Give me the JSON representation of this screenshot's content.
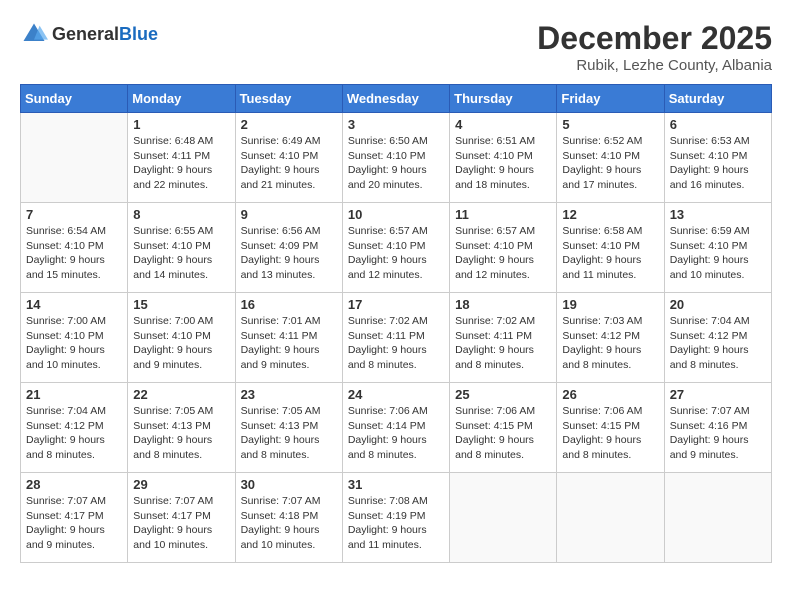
{
  "header": {
    "logo_general": "General",
    "logo_blue": "Blue",
    "month": "December 2025",
    "location": "Rubik, Lezhe County, Albania"
  },
  "days_of_week": [
    "Sunday",
    "Monday",
    "Tuesday",
    "Wednesday",
    "Thursday",
    "Friday",
    "Saturday"
  ],
  "weeks": [
    [
      {
        "day": "",
        "sunrise": "",
        "sunset": "",
        "daylight": ""
      },
      {
        "day": "1",
        "sunrise": "Sunrise: 6:48 AM",
        "sunset": "Sunset: 4:11 PM",
        "daylight": "Daylight: 9 hours and 22 minutes."
      },
      {
        "day": "2",
        "sunrise": "Sunrise: 6:49 AM",
        "sunset": "Sunset: 4:10 PM",
        "daylight": "Daylight: 9 hours and 21 minutes."
      },
      {
        "day": "3",
        "sunrise": "Sunrise: 6:50 AM",
        "sunset": "Sunset: 4:10 PM",
        "daylight": "Daylight: 9 hours and 20 minutes."
      },
      {
        "day": "4",
        "sunrise": "Sunrise: 6:51 AM",
        "sunset": "Sunset: 4:10 PM",
        "daylight": "Daylight: 9 hours and 18 minutes."
      },
      {
        "day": "5",
        "sunrise": "Sunrise: 6:52 AM",
        "sunset": "Sunset: 4:10 PM",
        "daylight": "Daylight: 9 hours and 17 minutes."
      },
      {
        "day": "6",
        "sunrise": "Sunrise: 6:53 AM",
        "sunset": "Sunset: 4:10 PM",
        "daylight": "Daylight: 9 hours and 16 minutes."
      }
    ],
    [
      {
        "day": "7",
        "sunrise": "Sunrise: 6:54 AM",
        "sunset": "Sunset: 4:10 PM",
        "daylight": "Daylight: 9 hours and 15 minutes."
      },
      {
        "day": "8",
        "sunrise": "Sunrise: 6:55 AM",
        "sunset": "Sunset: 4:10 PM",
        "daylight": "Daylight: 9 hours and 14 minutes."
      },
      {
        "day": "9",
        "sunrise": "Sunrise: 6:56 AM",
        "sunset": "Sunset: 4:09 PM",
        "daylight": "Daylight: 9 hours and 13 minutes."
      },
      {
        "day": "10",
        "sunrise": "Sunrise: 6:57 AM",
        "sunset": "Sunset: 4:10 PM",
        "daylight": "Daylight: 9 hours and 12 minutes."
      },
      {
        "day": "11",
        "sunrise": "Sunrise: 6:57 AM",
        "sunset": "Sunset: 4:10 PM",
        "daylight": "Daylight: 9 hours and 12 minutes."
      },
      {
        "day": "12",
        "sunrise": "Sunrise: 6:58 AM",
        "sunset": "Sunset: 4:10 PM",
        "daylight": "Daylight: 9 hours and 11 minutes."
      },
      {
        "day": "13",
        "sunrise": "Sunrise: 6:59 AM",
        "sunset": "Sunset: 4:10 PM",
        "daylight": "Daylight: 9 hours and 10 minutes."
      }
    ],
    [
      {
        "day": "14",
        "sunrise": "Sunrise: 7:00 AM",
        "sunset": "Sunset: 4:10 PM",
        "daylight": "Daylight: 9 hours and 10 minutes."
      },
      {
        "day": "15",
        "sunrise": "Sunrise: 7:00 AM",
        "sunset": "Sunset: 4:10 PM",
        "daylight": "Daylight: 9 hours and 9 minutes."
      },
      {
        "day": "16",
        "sunrise": "Sunrise: 7:01 AM",
        "sunset": "Sunset: 4:11 PM",
        "daylight": "Daylight: 9 hours and 9 minutes."
      },
      {
        "day": "17",
        "sunrise": "Sunrise: 7:02 AM",
        "sunset": "Sunset: 4:11 PM",
        "daylight": "Daylight: 9 hours and 8 minutes."
      },
      {
        "day": "18",
        "sunrise": "Sunrise: 7:02 AM",
        "sunset": "Sunset: 4:11 PM",
        "daylight": "Daylight: 9 hours and 8 minutes."
      },
      {
        "day": "19",
        "sunrise": "Sunrise: 7:03 AM",
        "sunset": "Sunset: 4:12 PM",
        "daylight": "Daylight: 9 hours and 8 minutes."
      },
      {
        "day": "20",
        "sunrise": "Sunrise: 7:04 AM",
        "sunset": "Sunset: 4:12 PM",
        "daylight": "Daylight: 9 hours and 8 minutes."
      }
    ],
    [
      {
        "day": "21",
        "sunrise": "Sunrise: 7:04 AM",
        "sunset": "Sunset: 4:12 PM",
        "daylight": "Daylight: 9 hours and 8 minutes."
      },
      {
        "day": "22",
        "sunrise": "Sunrise: 7:05 AM",
        "sunset": "Sunset: 4:13 PM",
        "daylight": "Daylight: 9 hours and 8 minutes."
      },
      {
        "day": "23",
        "sunrise": "Sunrise: 7:05 AM",
        "sunset": "Sunset: 4:13 PM",
        "daylight": "Daylight: 9 hours and 8 minutes."
      },
      {
        "day": "24",
        "sunrise": "Sunrise: 7:06 AM",
        "sunset": "Sunset: 4:14 PM",
        "daylight": "Daylight: 9 hours and 8 minutes."
      },
      {
        "day": "25",
        "sunrise": "Sunrise: 7:06 AM",
        "sunset": "Sunset: 4:15 PM",
        "daylight": "Daylight: 9 hours and 8 minutes."
      },
      {
        "day": "26",
        "sunrise": "Sunrise: 7:06 AM",
        "sunset": "Sunset: 4:15 PM",
        "daylight": "Daylight: 9 hours and 8 minutes."
      },
      {
        "day": "27",
        "sunrise": "Sunrise: 7:07 AM",
        "sunset": "Sunset: 4:16 PM",
        "daylight": "Daylight: 9 hours and 9 minutes."
      }
    ],
    [
      {
        "day": "28",
        "sunrise": "Sunrise: 7:07 AM",
        "sunset": "Sunset: 4:17 PM",
        "daylight": "Daylight: 9 hours and 9 minutes."
      },
      {
        "day": "29",
        "sunrise": "Sunrise: 7:07 AM",
        "sunset": "Sunset: 4:17 PM",
        "daylight": "Daylight: 9 hours and 10 minutes."
      },
      {
        "day": "30",
        "sunrise": "Sunrise: 7:07 AM",
        "sunset": "Sunset: 4:18 PM",
        "daylight": "Daylight: 9 hours and 10 minutes."
      },
      {
        "day": "31",
        "sunrise": "Sunrise: 7:08 AM",
        "sunset": "Sunset: 4:19 PM",
        "daylight": "Daylight: 9 hours and 11 minutes."
      },
      {
        "day": "",
        "sunrise": "",
        "sunset": "",
        "daylight": ""
      },
      {
        "day": "",
        "sunrise": "",
        "sunset": "",
        "daylight": ""
      },
      {
        "day": "",
        "sunrise": "",
        "sunset": "",
        "daylight": ""
      }
    ]
  ]
}
